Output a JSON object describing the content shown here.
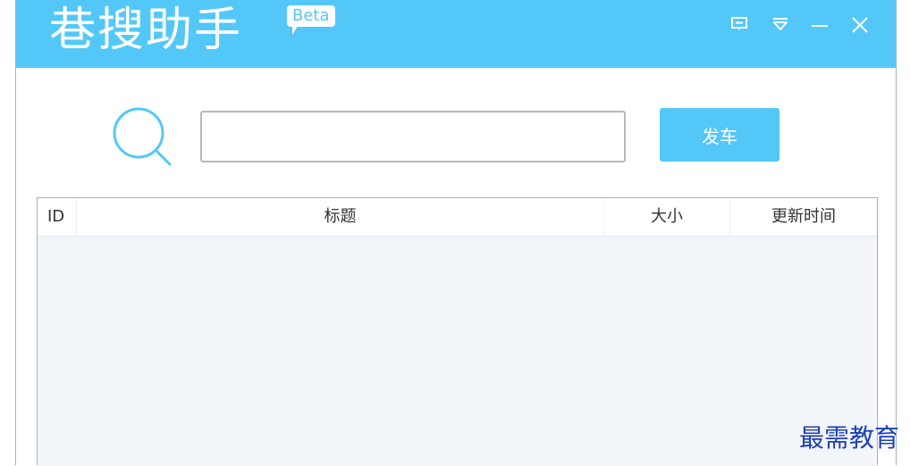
{
  "app": {
    "title": "巷搜助手",
    "badge": "Beta",
    "accent_color": "#53c8f8"
  },
  "titlebar": {
    "buttons": [
      {
        "icon": "feedback-icon",
        "glyph": "⊡"
      },
      {
        "icon": "dropdown-menu-icon",
        "glyph": "▽"
      },
      {
        "icon": "minimize-icon",
        "glyph": "—"
      },
      {
        "icon": "close-icon",
        "glyph": "✕"
      }
    ]
  },
  "search": {
    "icon": "search-icon",
    "value": "",
    "placeholder": "",
    "button_label": "发车"
  },
  "table": {
    "columns": [
      "ID",
      "标题",
      "大小",
      "更新时间"
    ],
    "rows": []
  },
  "watermark": {
    "text": "最需教育"
  }
}
